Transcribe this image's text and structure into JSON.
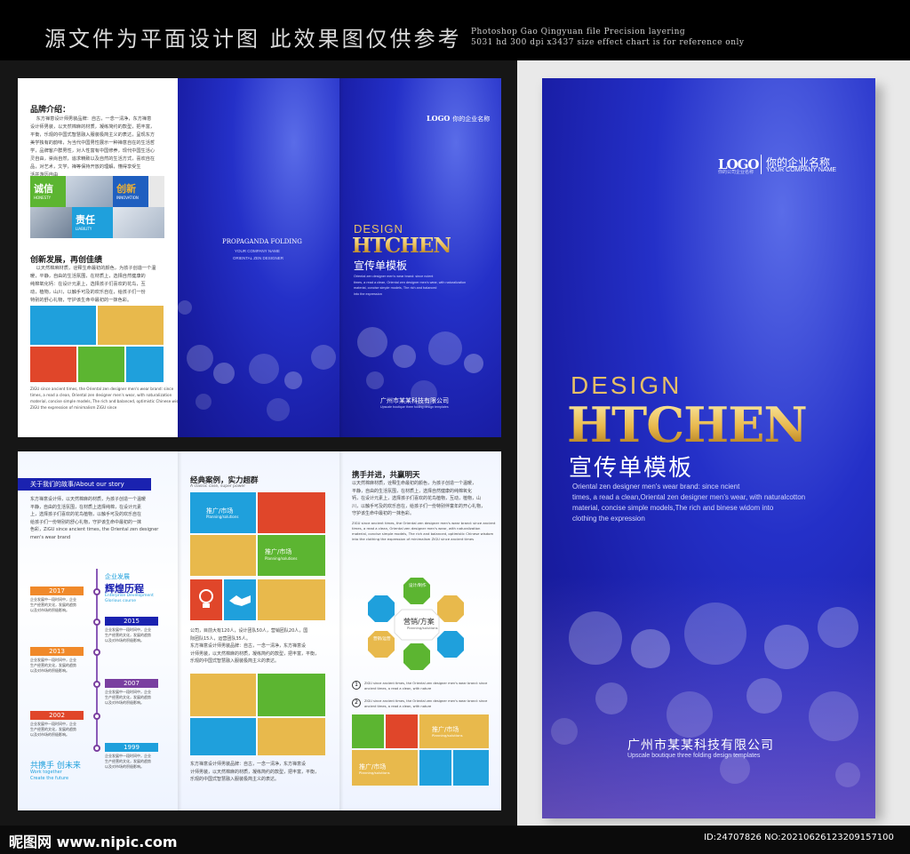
{
  "header": {
    "cn": "源文件为平面设计图 此效果图仅供参考",
    "en1": "Photoshop Gao Qingyuan file Precision layering",
    "en2": "5031 hd 300 dpi x3437 size effect chart is for reference only"
  },
  "inside": {
    "brand_title": "品牌介绍：",
    "brand_text": "    东方禅意设计师男装品牌：自古，一念一清净，东方禅意\n设计师男装，以天然棉麻的材质，凝练简约的款型，把丰富，\n平衡，乐观的中国式智慧融入服装极简主义的表达，呈现东方\n美学独有的韵味，为当代中国男性展示一种禅意自在的生活哲\n学，品牌客户群男性，对人性富有中国修养，现代中国生活心\n灵自由，崇尚自然，追求精致以及自然的生活方式，喜欢自在\n品，对艺术，文学，禅等保持开放的理解，懂得享受生\n活并游历自由",
    "tiles": {
      "t1": "诚信",
      "t1s": "HONESTY",
      "t2": "创新",
      "t2s": "INNOVATION",
      "t3": "责任",
      "t3s": "LIABILITY"
    },
    "dev_title": "创新发展，再创佳绩",
    "dev_text": "    以天然棉麻材质，诠释生命最初的颜色，为孩子创造一个温\n暖，平静，自由的生活氛围，在材质上，选择自然健康的\n纯棉氧化钙：在设计元素上，选择孩子们喜欢的花鸟，互\n动，植物，山川，以触手可及的欢乐自在，给孩子们一份\n特别的舒心礼物，守护该生命中最初的一抹色彩。",
    "small_en": "ZiGU since ancient times, the Oriental zen designer men's wear brand: since\ntimes, a read a clean, Oriental zen designer men's wear, with naturalization\nmaterial, concise simple models, The rich and balanced, optimistic Chinese wisdom into\nZiGU the expression of minimalism ZiGU since"
  },
  "middle": {
    "prop": "PROPAGANDA FOLDING",
    "company_small": "YOUR COMPANY NAME",
    "sub": "ORIENTAL ZEN DESIGNER"
  },
  "cover_small": {
    "logo": "LOGO",
    "company": "你的企业名称",
    "design": "DESIGN",
    "brand": "HTCHEN",
    "cn": "宣传单模板",
    "desc": "Oriental zen designer men's wear brand: since ncient\ntimes, a read a clean, Oriental zen designer men's wear, with naturalization\nmaterial, concise simple models, The rich and balanced\ninto the expression",
    "footer_cn": "广州市某某科技有限公司",
    "footer_en": "Upscale boutique three folding design templates"
  },
  "story": {
    "title": "关于我们的故事/About our story",
    "text": "东方禅意设计师，以天然棉麻的材质，为孩子创造一个温暖\n平静，自由的生活氛围，在材质上选择纯棉，在设计元素\n上，选择孩子们喜欢的花鸟植物，以触手可及的欢乐自在\n给孩子们一份特别的舒心礼物，守护该生命中最初的一抹\n色彩，ZiGU since ancient times, the Oriental zen designer\nmen's wear brand",
    "dev_cn": "企业发展",
    "dev_big": "辉煌历程",
    "dev_en": "Enterprise Development\nGlorious course",
    "years": [
      "2017",
      "2015",
      "2013",
      "2007",
      "2002",
      "1999"
    ],
    "tl_text": "企业发展中一段时间中，企业\n生产经营的文化，发展的趋势\n以及对市场的积极影响。",
    "future_cn": "共携手 创未来",
    "future_en": "Work together\nCreate the future"
  },
  "cases": {
    "title": "经典案例，实力超群",
    "sub": "A classic case, super power",
    "l1": "推广/市场",
    "l1s": "Planning/solutions",
    "l2": "推广/市场",
    "l2s": "Planning/solutions",
    "text1": "公司，目前大有120人，设计团队50人，营销团队20人，国\n际团队15人，运营团队35人。\n东方禅意设计师男装品牌：自古，一念一清净，东方禅意设\n计师男装，以天然棉麻的材质，凝练简约的款型，把丰富，平衡，\n乐观的中国式智慧融入服装极简主义的表达。",
    "text2": "东方禅意设计师男装品牌：自古，一念一清净，东方禅意设\n计师男装，以天然棉麻的材质，凝练简约的款型，把丰富，平衡，\n乐观的中国式智慧融入服装极简主义的表达。"
  },
  "win": {
    "title": "携手并进，共赢明天",
    "text": "以天然棉麻材质，诠释生命最初的颜色，为孩子创造一个温暖，\n平静，自由的生活氛围，在材质上，选择自然健康的纯棉氧化\n钙，在设计元素上，选择孩子们喜欢的花鸟植物，互动，植物，山\n川，以触手可及的欢乐自在，给孩子们一份特别伴童年的开心礼物，\n守护该生命中最初的一抹色彩。",
    "en": "ZiGU since ancient times, the Oriental zen designer men's wear brand: since ancient\ntimes, a read a clean, Oriental zen designer men's wear, with naturalization\nmaterial, concise simple models, The rich and balanced, optimistic Chinese wisdom\ninto the clothing the expression of minimalism ZiGU since ancient times",
    "design": "设计/制作",
    "sales": "营销/方案",
    "sales_en": "Planning/solutions",
    "ops": "营销/运营",
    "n1": "ZiGU since ancient times, the Oriental zen designer men's wear brand: since\nancient times, a read a clean, with nature",
    "n2": "ZiGU since ancient times, the Oriental zen designer men's wear brand: since\nancient times, a read a clean, with nature",
    "l1": "推广/市场",
    "l1s": "Planning/solutions",
    "l2": "推广/市场",
    "l2s": "Planning/solutions"
  },
  "cover": {
    "logo": "LOGO",
    "company": "你的企业名称",
    "company_en": "YOUR COMPANY NAME",
    "slogan": "你的公司企业名称",
    "design": "DESIGN",
    "brand": "HTCHEN",
    "cn": "宣传单模板",
    "desc1": "Oriental zen designer men's wear brand: since ncient",
    "desc2": "times, a read a clean,Oriental zen designer men's wear, with naturalcotton",
    "desc3": "material, concise simple models,The rich and binese widom into",
    "desc4": "clothing the expression",
    "footer_cn": "广州市某某科技有限公司",
    "footer_en": "Upscale boutique three folding design templates"
  },
  "footer": {
    "left": "昵图网 www.nipic.com",
    "right": "ID:24707826 NO:20210626123209157100"
  },
  "colors": {
    "blue": "#1fa0dc",
    "green": "#5cb531",
    "yellow": "#e8b94c",
    "red": "#e0462a",
    "orange": "#f0892a",
    "purple": "#7a3fa0",
    "navy": "#1a22b0"
  }
}
